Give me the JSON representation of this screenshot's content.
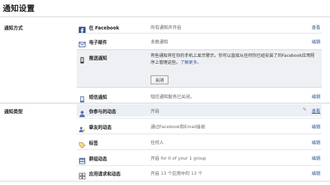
{
  "page_title": "通知设置",
  "sections": {
    "methods_label": "通知方式",
    "types_label": "通知类型"
  },
  "methods": [
    {
      "name": "在 Facebook",
      "value": "所有通知声开启",
      "action": "查看",
      "icon": "facebook-icon"
    },
    {
      "name": "电子邮件",
      "value": "多数通知",
      "action": "编辑",
      "icon": "email-icon"
    },
    {
      "name": "推送通知",
      "icon": "phone-icon",
      "description": "有些通知将在你的手机上显示警示。你可以直接从任何你已经安装了的Facebook应用程序上管理这些。",
      "learn_more": "了解更多。",
      "close_label": "关闭"
    },
    {
      "name": "短信通知",
      "value": "短信通知服务已关闭。",
      "action": "编辑",
      "icon": "sms-icon"
    }
  ],
  "types": [
    {
      "name": "你参与的动态",
      "value": "开启",
      "action": "查看",
      "icon": "person-icon"
    },
    {
      "name": "挚友的动态",
      "value": "通过Facebook和Email接收",
      "action": "编辑",
      "icon": "star-icon"
    },
    {
      "name": "标签",
      "value": "任何人",
      "action": "编辑",
      "icon": "tag-icon"
    },
    {
      "name": "群组动态",
      "value": "开启 for 0 of your 1 group",
      "action": "编辑",
      "icon": "group-icon"
    },
    {
      "name": "应用请求和动态",
      "value": "开启 13 个应用中的 13 个",
      "action": "编辑",
      "icon": "app-icon"
    }
  ],
  "colors": {
    "link": "#3b5998",
    "facebook_blue": "#3b5998",
    "highlight_row": "#eceff5"
  }
}
